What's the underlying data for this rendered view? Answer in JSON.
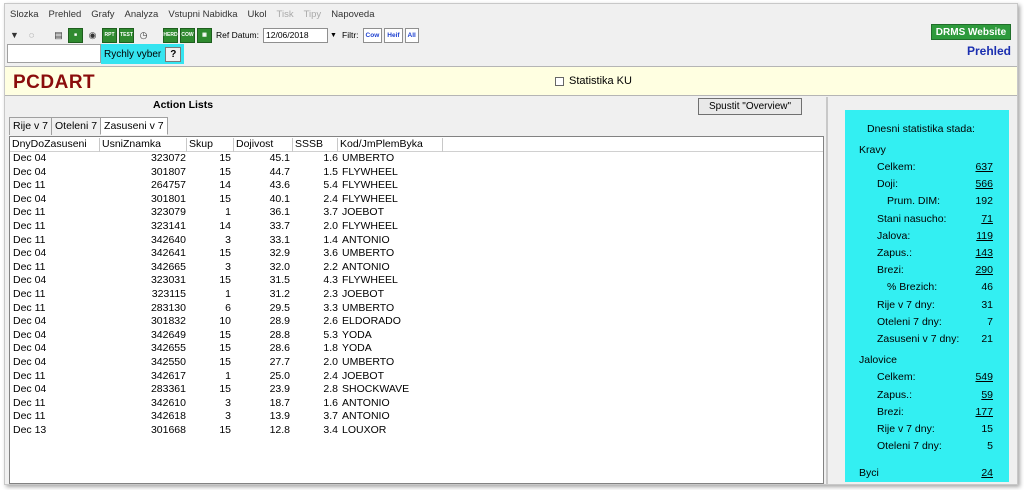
{
  "menu": [
    {
      "label": "Slozka",
      "enabled": true
    },
    {
      "label": "Prehled",
      "enabled": true
    },
    {
      "label": "Grafy",
      "enabled": true
    },
    {
      "label": "Analyza",
      "enabled": true
    },
    {
      "label": "Vstupni Nabidka",
      "enabled": true
    },
    {
      "label": "Ukol",
      "enabled": true
    },
    {
      "label": "Tisk",
      "enabled": false
    },
    {
      "label": "Tipy",
      "enabled": false
    },
    {
      "label": "Napoveda",
      "enabled": true
    }
  ],
  "toolbar": {
    "ref_label": "Ref Datum:",
    "ref_value": "12/06/2018",
    "filter_label": "Filtr:",
    "filter_cow": "Cow",
    "filter_heif": "Heif",
    "filter_all": "All"
  },
  "drms_button": "DRMS Website",
  "view_title": "Prehled",
  "quick_select": {
    "label": "Rychly vyber",
    "help": "?"
  },
  "app_title": "PCDART",
  "statistika_checkbox": "Statistika KU",
  "action_lists": {
    "title": "Action Lists",
    "run_button": "Spustit  \"Overview\"",
    "tabs": [
      "Rije v 7",
      "Oteleni 7",
      "Zasuseni v 7"
    ],
    "active_tab": 2,
    "columns": [
      "DnyDoZasuseni",
      "UsniZnamka",
      "Skup",
      "Dojivost",
      "SSSB",
      "Kod/JmPlemByka"
    ],
    "rows": [
      [
        "Dec 04",
        "323072",
        "15",
        "45.1",
        "1.6",
        "UMBERTO"
      ],
      [
        "Dec 04",
        "301807",
        "15",
        "44.7",
        "1.5",
        "FLYWHEEL"
      ],
      [
        "Dec 11",
        "264757",
        "14",
        "43.6",
        "5.4",
        "FLYWHEEL"
      ],
      [
        "Dec 04",
        "301801",
        "15",
        "40.1",
        "2.4",
        "FLYWHEEL"
      ],
      [
        "Dec 11",
        "323079",
        "1",
        "36.1",
        "3.7",
        "JOEBOT"
      ],
      [
        "Dec 11",
        "323141",
        "14",
        "33.7",
        "2.0",
        "FLYWHEEL"
      ],
      [
        "Dec 11",
        "342640",
        "3",
        "33.1",
        "1.4",
        "ANTONIO"
      ],
      [
        "Dec 04",
        "342641",
        "15",
        "32.9",
        "3.6",
        "UMBERTO"
      ],
      [
        "Dec 11",
        "342665",
        "3",
        "32.0",
        "2.2",
        "ANTONIO"
      ],
      [
        "Dec 04",
        "323031",
        "15",
        "31.5",
        "4.3",
        "FLYWHEEL"
      ],
      [
        "Dec 11",
        "323115",
        "1",
        "31.2",
        "2.3",
        "JOEBOT"
      ],
      [
        "Dec 11",
        "283130",
        "6",
        "29.5",
        "3.3",
        "UMBERTO"
      ],
      [
        "Dec 04",
        "301832",
        "10",
        "28.9",
        "2.6",
        "ELDORADO"
      ],
      [
        "Dec 04",
        "342649",
        "15",
        "28.8",
        "5.3",
        "YODA"
      ],
      [
        "Dec 04",
        "342655",
        "15",
        "28.6",
        "1.8",
        "YODA"
      ],
      [
        "Dec 04",
        "342550",
        "15",
        "27.7",
        "2.0",
        "UMBERTO"
      ],
      [
        "Dec 11",
        "342617",
        "1",
        "25.0",
        "2.4",
        "JOEBOT"
      ],
      [
        "Dec 04",
        "283361",
        "15",
        "23.9",
        "2.8",
        "SHOCKWAVE"
      ],
      [
        "Dec 11",
        "342610",
        "3",
        "18.7",
        "1.6",
        "ANTONIO"
      ],
      [
        "Dec 11",
        "342618",
        "3",
        "13.9",
        "3.7",
        "ANTONIO"
      ],
      [
        "Dec 13",
        "301668",
        "15",
        "12.8",
        "3.4",
        "LOUXOR"
      ]
    ]
  },
  "stats": {
    "title": "Dnesni statistika stada:",
    "items": [
      {
        "label": "Kravy",
        "value": "",
        "link": false,
        "indent": 0,
        "gap": 16
      },
      {
        "label": "Celkem:",
        "value": "637",
        "link": true,
        "indent": 1
      },
      {
        "label": "Doji:",
        "value": "566",
        "link": true,
        "indent": 1
      },
      {
        "label": "Prum. DIM:",
        "value": "192",
        "link": false,
        "indent": 2
      },
      {
        "label": "Stani nasucho:",
        "value": "71",
        "link": true,
        "indent": 1
      },
      {
        "label": "Jalova:",
        "value": "119",
        "link": true,
        "indent": 1
      },
      {
        "label": "Zapus.:",
        "value": "143",
        "link": true,
        "indent": 1
      },
      {
        "label": "Brezi:",
        "value": "290",
        "link": true,
        "indent": 1
      },
      {
        "label": "% Brezich:",
        "value": "46",
        "link": false,
        "indent": 2
      },
      {
        "label": "Rije v 7 dny:",
        "value": "31",
        "link": false,
        "indent": 1
      },
      {
        "label": "Oteleni 7 dny:",
        "value": "7",
        "link": false,
        "indent": 1
      },
      {
        "label": "Zasuseni v 7 dny:",
        "value": "21",
        "link": false,
        "indent": 1
      },
      {
        "label": "Jalovice",
        "value": "",
        "link": false,
        "indent": 0
      },
      {
        "label": "Celkem:",
        "value": "549",
        "link": true,
        "indent": 1
      },
      {
        "label": "Zapus.:",
        "value": "59",
        "link": true,
        "indent": 1
      },
      {
        "label": "Brezi:",
        "value": "177",
        "link": true,
        "indent": 1
      },
      {
        "label": "Rije v 7 dny:",
        "value": "15",
        "link": false,
        "indent": 1
      },
      {
        "label": "Oteleni 7 dny:",
        "value": "5",
        "link": false,
        "indent": 1
      },
      {
        "label": "Byci",
        "value": "24",
        "link": true,
        "indent": 0
      }
    ]
  },
  "colors": {
    "title": "#8a0c0c",
    "stats_bg": "#33eff2",
    "drms": "#2e9a3c",
    "view_title": "#1b2fb0"
  }
}
